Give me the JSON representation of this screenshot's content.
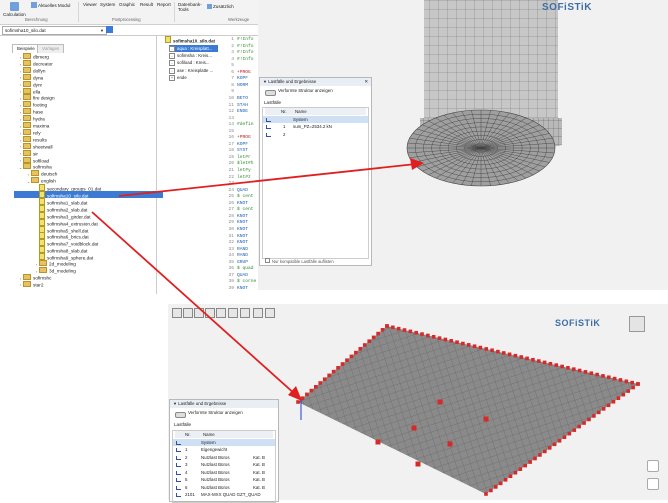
{
  "ribbon": {
    "calculation": "Calculation",
    "aktuelles_modul": "Aktuelles Modul",
    "berechnung": "Berechnung",
    "viewer": "Viewer",
    "system": "System",
    "graphic": "Graphic",
    "result": "Result",
    "report": "Report",
    "postprocessing": "Postprocessing",
    "datenbank_tools": "Datenbank-\nTools",
    "zusaetzlich": "Zusätzlich",
    "werkzeuge": "Werkzeuge"
  },
  "filebar": {
    "current_file": "sofimsha10_silo.dat"
  },
  "explorer": {
    "tabs": [
      "Beispiele",
      "Vorlagen"
    ],
    "items": [
      {
        "label": "dbmerg",
        "indent": 0,
        "kind": "folder",
        "toggle": "›"
      },
      {
        "label": "decreator",
        "indent": 0,
        "kind": "folder",
        "toggle": "›"
      },
      {
        "label": "dolfyn",
        "indent": 0,
        "kind": "folder",
        "toggle": "›"
      },
      {
        "label": "dyna",
        "indent": 0,
        "kind": "folder",
        "toggle": "›"
      },
      {
        "label": "dynr",
        "indent": 0,
        "kind": "folder",
        "toggle": "›"
      },
      {
        "label": "ella",
        "indent": 0,
        "kind": "folder",
        "toggle": "›"
      },
      {
        "label": "fire design",
        "indent": 0,
        "kind": "folder",
        "toggle": "›"
      },
      {
        "label": "footing",
        "indent": 0,
        "kind": "folder",
        "toggle": "›"
      },
      {
        "label": "hase",
        "indent": 0,
        "kind": "folder",
        "toggle": "›"
      },
      {
        "label": "hydra",
        "indent": 0,
        "kind": "folder",
        "toggle": "›"
      },
      {
        "label": "maxima",
        "indent": 0,
        "kind": "folder",
        "toggle": "›"
      },
      {
        "label": "rely",
        "indent": 0,
        "kind": "folder",
        "toggle": "›"
      },
      {
        "label": "results",
        "indent": 0,
        "kind": "folder",
        "toggle": "›"
      },
      {
        "label": "sheetwall",
        "indent": 0,
        "kind": "folder",
        "toggle": "›"
      },
      {
        "label": "sir",
        "indent": 0,
        "kind": "folder",
        "toggle": "›"
      },
      {
        "label": "sofiload",
        "indent": 0,
        "kind": "folder",
        "toggle": "›"
      },
      {
        "label": "sofimsha",
        "indent": 0,
        "kind": "folder",
        "toggle": "⌄"
      },
      {
        "label": "deutsch",
        "indent": 1,
        "kind": "folder",
        "toggle": "›"
      },
      {
        "label": "english",
        "indent": 1,
        "kind": "folder",
        "toggle": "⌄"
      },
      {
        "label": "secondary_groups_01.dat",
        "indent": 2,
        "kind": "file",
        "toggle": ""
      },
      {
        "label": "sofimsha10_silo.dat",
        "indent": 2,
        "kind": "file",
        "toggle": "",
        "selected": true
      },
      {
        "label": "sofimsha1_slab.dat",
        "indent": 2,
        "kind": "file",
        "toggle": ""
      },
      {
        "label": "sofimsha2_slab.dat",
        "indent": 2,
        "kind": "file",
        "toggle": ""
      },
      {
        "label": "sofimsha3_girder.dat",
        "indent": 2,
        "kind": "file",
        "toggle": ""
      },
      {
        "label": "sofimsha4_extrusion.dat",
        "indent": 2,
        "kind": "file",
        "toggle": ""
      },
      {
        "label": "sofimsha5_shell.dat",
        "indent": 2,
        "kind": "file",
        "toggle": ""
      },
      {
        "label": "sofimsha6_brics.dat",
        "indent": 2,
        "kind": "file",
        "toggle": ""
      },
      {
        "label": "sofimsha7_voidblock.dat",
        "indent": 2,
        "kind": "file",
        "toggle": ""
      },
      {
        "label": "sofimsha8_slab.dat",
        "indent": 2,
        "kind": "file",
        "toggle": ""
      },
      {
        "label": "sofimsha9_sphere.dat",
        "indent": 2,
        "kind": "file",
        "toggle": ""
      },
      {
        "label": "2d_modeling",
        "indent": 2,
        "kind": "folder",
        "toggle": "›"
      },
      {
        "label": "3d_modeling",
        "indent": 2,
        "kind": "folder",
        "toggle": "›"
      },
      {
        "label": "sofimshc",
        "indent": 0,
        "kind": "folder",
        "toggle": "›"
      },
      {
        "label": "star2",
        "indent": 0,
        "kind": "folder",
        "toggle": "›"
      }
    ]
  },
  "midpanel": {
    "header": "sofimsha10_silo.dat",
    "items": [
      {
        "box": "-",
        "label": "aqua : Kreisplatt..."
      },
      {
        "box": "-",
        "label": "sofimsha : Kreis..."
      },
      {
        "box": "-",
        "label": "sofiload : Kreis..."
      },
      {
        "box": "-",
        "label": "ase : Kreisplatte ..."
      },
      {
        "box": "+",
        "label": "ende"
      }
    ]
  },
  "editor": {
    "lines": [
      {
        "n": "1",
        "t": "#!Info",
        "c": "#2a8a2a"
      },
      {
        "n": "2",
        "t": "#!Info",
        "c": "#2a8a2a"
      },
      {
        "n": "3",
        "t": "#!Info",
        "c": "#2a8a2a"
      },
      {
        "n": "4",
        "t": "#!Info",
        "c": "#2a8a2a"
      },
      {
        "n": "5",
        "t": "",
        "c": "#222"
      },
      {
        "n": "6",
        "t": "+PROG",
        "c": "#c02020"
      },
      {
        "n": "7",
        "t": "KOPF",
        "c": "#1d5fb8"
      },
      {
        "n": "8",
        "t": "NORM",
        "c": "#1d5fb8"
      },
      {
        "n": "9",
        "t": "",
        "c": "#222"
      },
      {
        "n": "10",
        "t": "BETO",
        "c": "#1d5fb8"
      },
      {
        "n": "11",
        "t": "STAH",
        "c": "#1d5fb8"
      },
      {
        "n": "12",
        "t": "ENDE",
        "c": "#1d5fb8"
      },
      {
        "n": "13",
        "t": "",
        "c": "#222"
      },
      {
        "n": "14",
        "t": "#defin",
        "c": "#2a8a2a"
      },
      {
        "n": "15",
        "t": "",
        "c": "#222"
      },
      {
        "n": "16",
        "t": "+PROG",
        "c": "#c02020"
      },
      {
        "n": "17",
        "t": "KOPF",
        "c": "#1d5fb8"
      },
      {
        "n": "18",
        "t": "SYST",
        "c": "#1d5fb8"
      },
      {
        "n": "19",
        "t": "let#r",
        "c": "#2a8a2a"
      },
      {
        "n": "20",
        "t": "$let#h",
        "c": "#2a8a2a"
      },
      {
        "n": "21",
        "t": "let#y",
        "c": "#2a8a2a"
      },
      {
        "n": "22",
        "t": "let#z",
        "c": "#2a8a2a"
      },
      {
        "n": "23",
        "t": "",
        "c": "#222"
      },
      {
        "n": "24",
        "t": "QUAD",
        "c": "#1d5fb8"
      },
      {
        "n": "25",
        "t": "$ cent",
        "c": "#2a8a2a"
      },
      {
        "n": "26",
        "t": "KNOT",
        "c": "#1d5fb8"
      },
      {
        "n": "27",
        "t": "$ cent",
        "c": "#2a8a2a"
      },
      {
        "n": "28",
        "t": "KNOT",
        "c": "#1d5fb8"
      },
      {
        "n": "29",
        "t": "KNOT",
        "c": "#1d5fb8"
      },
      {
        "n": "30",
        "t": "KNOT",
        "c": "#1d5fb8"
      },
      {
        "n": "31",
        "t": "KNOT",
        "c": "#1d5fb8"
      },
      {
        "n": "32",
        "t": "KNOT",
        "c": "#1d5fb8"
      },
      {
        "n": "33",
        "t": "RAND",
        "c": "#1d5fb8"
      },
      {
        "n": "34",
        "t": "RAND",
        "c": "#1d5fb8"
      },
      {
        "n": "35",
        "t": "GRUP",
        "c": "#1d5fb8"
      },
      {
        "n": "36",
        "t": "$ quad",
        "c": "#2a8a2a"
      },
      {
        "n": "37",
        "t": "QUAD",
        "c": "#1d5fb8"
      },
      {
        "n": "38",
        "t": "$ corne",
        "c": "#2a8a2a"
      },
      {
        "n": "39",
        "t": "KNOT",
        "c": "#1d5fb8"
      }
    ]
  },
  "logo": "SOFiSTiK",
  "panel_top": {
    "title": "Lastfälle und Ergebnisse",
    "toggle_label": "Verformte Struktur anzeigen",
    "section": "Lastfälle",
    "headers": [
      "Nr.",
      "Name"
    ],
    "rows": [
      {
        "nr": "",
        "name": "System",
        "kat": "",
        "highlight": true
      },
      {
        "nr": "1",
        "name": "sum_PZ=2534.2 kN",
        "kat": "",
        "highlight": false
      },
      {
        "nr": "2",
        "name": "",
        "kat": "",
        "highlight": false
      }
    ],
    "footer": "Nur kompatible Lastfälle auflisten"
  },
  "panel_bottom": {
    "title": "Lastfälle und Ergebnisse",
    "toggle_label": "Verformte Struktur anzeigen",
    "section": "Lastfälle",
    "headers": [
      "Nr.",
      "Name"
    ],
    "rows": [
      {
        "nr": "",
        "name": "System",
        "kat": "",
        "highlight": true
      },
      {
        "nr": "1",
        "name": "Eigengewicht",
        "kat": "",
        "highlight": false
      },
      {
        "nr": "2",
        "name": "Nutzlast Büros",
        "kat": "Kat. B",
        "highlight": false
      },
      {
        "nr": "3",
        "name": "Nutzlast Büros",
        "kat": "Kat. B",
        "highlight": false
      },
      {
        "nr": "4",
        "name": "Nutzlast Büros",
        "kat": "Kat. B",
        "highlight": false
      },
      {
        "nr": "5",
        "name": "Nutzlast Büros",
        "kat": "Kat. B",
        "highlight": false
      },
      {
        "nr": "6",
        "name": "Nutzlast Büros",
        "kat": "Kat. B",
        "highlight": false
      },
      {
        "nr": "2101",
        "name": "MAX-MXX QUAD GZT_QUAD",
        "kat": "",
        "highlight": false
      }
    ]
  },
  "colors": {
    "accent": "#3b7bd4",
    "arrow": "#e02020",
    "mesh": "#8c8c8c",
    "support": "#d62a2a"
  }
}
